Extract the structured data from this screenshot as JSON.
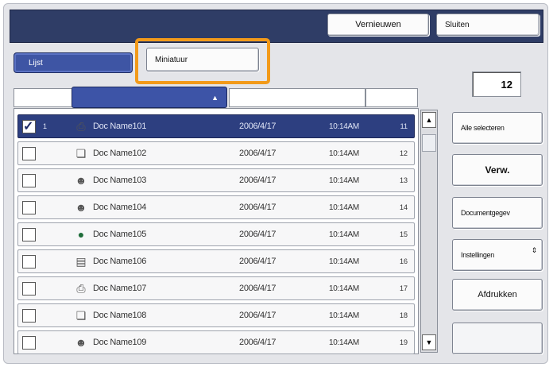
{
  "header": {
    "refresh_label": "Vernieuwen",
    "close_label": "Sluiten"
  },
  "tabs": {
    "list_label": "Lijst",
    "thumbnail_label": "Miniatuur"
  },
  "counter": {
    "value": "12"
  },
  "sort": {
    "arrow": "▲"
  },
  "rows": [
    {
      "checked": true,
      "num": "1",
      "icon": "printer-icon",
      "name": "Doc Name101",
      "date": "2006/4/17",
      "time": "10:14AM",
      "page": "11"
    },
    {
      "checked": false,
      "num": "",
      "icon": "document-icon",
      "name": "Doc Name102",
      "date": "2006/4/17",
      "time": "10:14AM",
      "page": "12"
    },
    {
      "checked": false,
      "num": "",
      "icon": "user-icon",
      "name": "Doc Name103",
      "date": "2006/4/17",
      "time": "10:14AM",
      "page": "13"
    },
    {
      "checked": false,
      "num": "",
      "icon": "user-icon",
      "name": "Doc Name104",
      "date": "2006/4/17",
      "time": "10:14AM",
      "page": "14"
    },
    {
      "checked": false,
      "num": "",
      "icon": "globe-icon",
      "name": "Doc Name105",
      "date": "2006/4/17",
      "time": "10:14AM",
      "page": "15"
    },
    {
      "checked": false,
      "num": "",
      "icon": "folder-icon",
      "name": "Doc Name106",
      "date": "2006/4/17",
      "time": "10:14AM",
      "page": "16"
    },
    {
      "checked": false,
      "num": "",
      "icon": "printer-icon",
      "name": "Doc Name107",
      "date": "2006/4/17",
      "time": "10:14AM",
      "page": "17"
    },
    {
      "checked": false,
      "num": "",
      "icon": "document-icon",
      "name": "Doc Name108",
      "date": "2006/4/17",
      "time": "10:14AM",
      "page": "18"
    },
    {
      "checked": false,
      "num": "",
      "icon": "user-icon",
      "name": "Doc Name109",
      "date": "2006/4/17",
      "time": "10:14AM",
      "page": "19"
    }
  ],
  "sidebar": {
    "select_all": "Alle selecteren",
    "delete": "Verw.",
    "doc_details": "Documentgegev",
    "settings": "Instellingen",
    "print": "Afdrukken",
    "empty": ""
  },
  "colors": {
    "highlight": "#f29a1a",
    "titlebar": "#2f3d66",
    "selected_row": "#2d3f80",
    "active_tab": "#3e55a4"
  }
}
